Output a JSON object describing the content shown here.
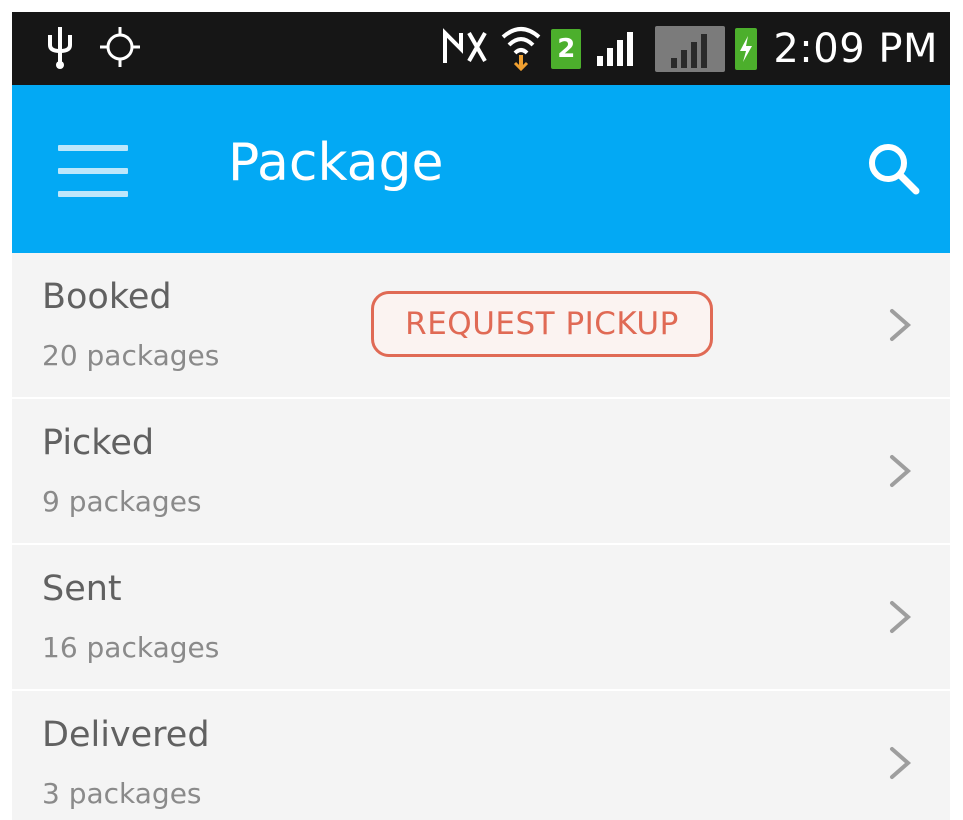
{
  "status_bar": {
    "time": "2:09 PM",
    "sim_slot": "2",
    "icons": [
      "usb-icon",
      "gps-icon",
      "mute-icon",
      "wifi-icon",
      "signal-icon",
      "battery-charging-icon"
    ]
  },
  "app_bar": {
    "title": "Package",
    "color": "#03a9f4"
  },
  "list": {
    "items": [
      {
        "title": "Booked",
        "subtitle": "20 packages",
        "action_label": "REQUEST PICKUP"
      },
      {
        "title": "Picked",
        "subtitle": "9 packages"
      },
      {
        "title": "Sent",
        "subtitle": "16 packages"
      },
      {
        "title": "Delivered",
        "subtitle": "3 packages"
      }
    ]
  },
  "colors": {
    "accent": "#e06a55",
    "list_background": "#f4f4f4"
  }
}
